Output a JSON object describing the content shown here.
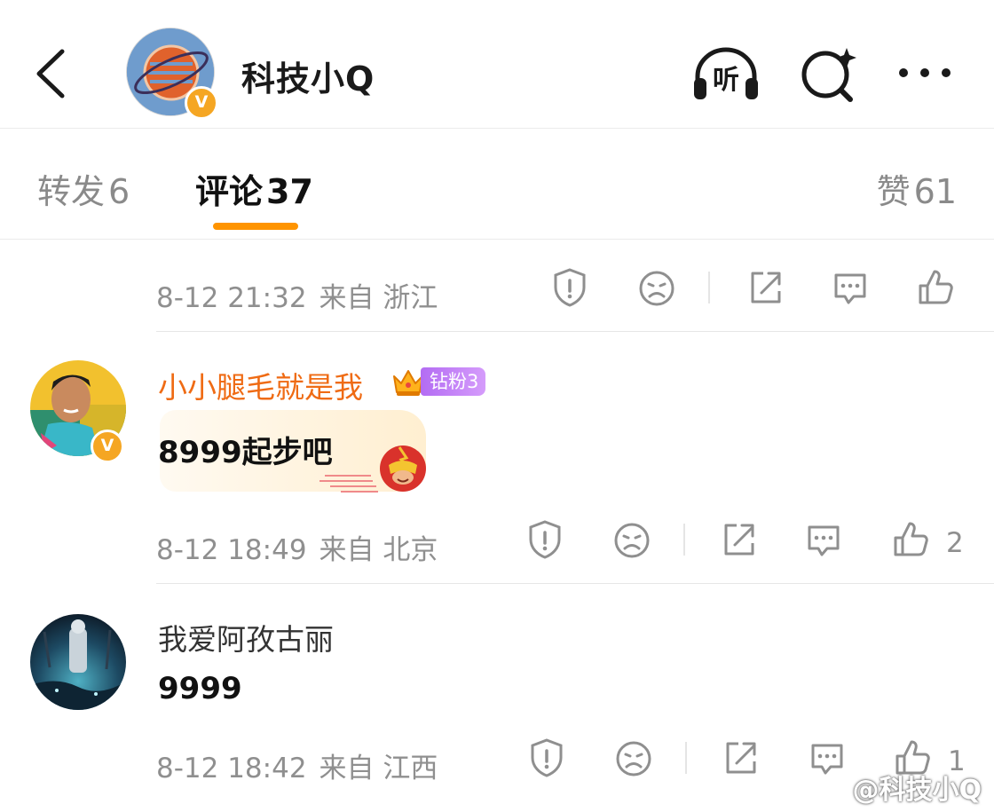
{
  "header": {
    "title": "科技小Q",
    "verified_mark": "V",
    "listen_label": "听"
  },
  "tabs": {
    "repost": {
      "label": "转发",
      "count": "6"
    },
    "comment": {
      "label": "评论",
      "count": "37"
    },
    "like": {
      "label": "赞",
      "count": "61"
    }
  },
  "comments": [
    {
      "time": "8-12 21:32",
      "source": "来自 浙江",
      "likes": ""
    },
    {
      "user": "小小腿毛就是我",
      "fan_badge": "钻粉3",
      "verified_mark": "V",
      "text": "8999起步吧",
      "time": "8-12 18:49",
      "source": "来自 北京",
      "likes": "2"
    },
    {
      "user": "我爱阿孜古丽",
      "text": "9999",
      "time": "8-12 18:42",
      "source": "来自 江西",
      "likes": "1"
    }
  ],
  "watermark": "@科技小Q",
  "colors": {
    "accent": "#ff9400",
    "username_vip": "#ef6b14",
    "meta_gray": "#8f8f8f",
    "fan_badge": "#b36cf3",
    "verified": "#f5a623"
  }
}
